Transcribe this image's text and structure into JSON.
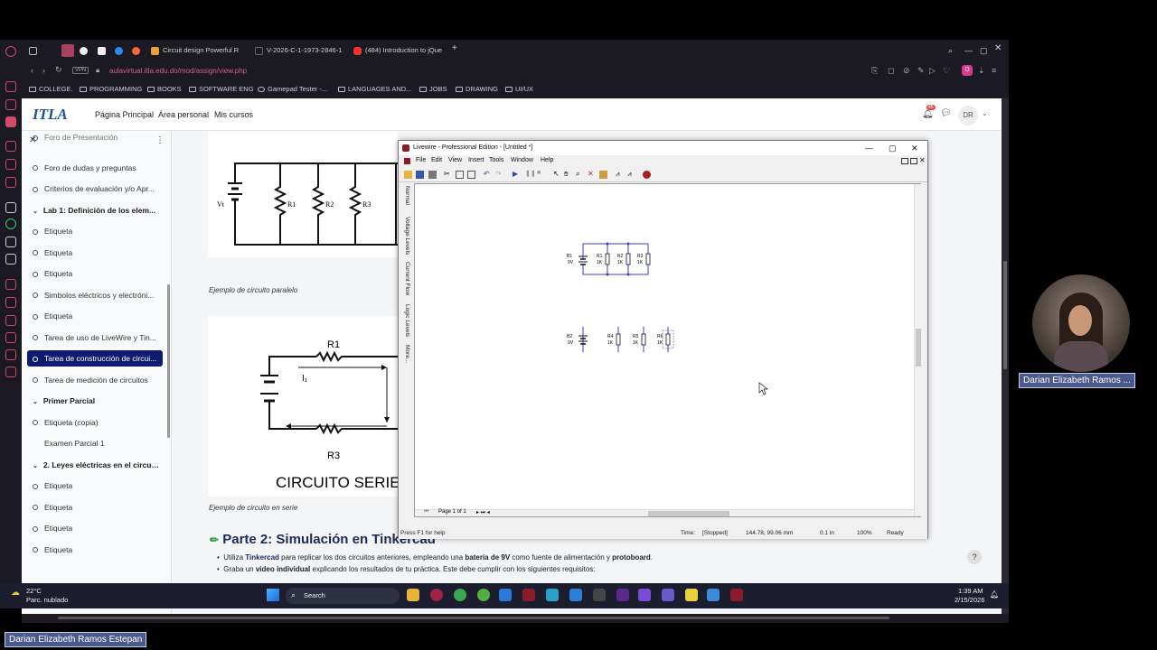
{
  "browser": {
    "tabs": [
      {
        "label": "Circuit design Powerful R"
      },
      {
        "label": "V-2026-C-1-1973-2846-1"
      },
      {
        "label": "(484) Introduction to jQue"
      }
    ],
    "url": "aulavirtual.itla.edu.do/mod/assign/view.php",
    "bookmarks": [
      "COLLEGE.",
      "PROGRAMMING",
      "BOOKS",
      "SOFTWARE ENG",
      "Gamepad Tester -...",
      "LANGUAGES AND...",
      "JOBS",
      "DRAWING",
      "UI/UX"
    ],
    "notification_count": "45"
  },
  "moodle": {
    "logo": "ITLA",
    "nav": [
      "Página Principal",
      "Área personal",
      "Mis cursos"
    ],
    "user_initials": "DR",
    "drawer_items": [
      {
        "label": "Foro de Presentación",
        "type": "item"
      },
      {
        "label": "Foro de dudas y preguntas",
        "type": "item"
      },
      {
        "label": "Criterios de evaluación y/o Apr...",
        "type": "item"
      },
      {
        "label": "Lab 1: Definición de los elem...",
        "type": "section"
      },
      {
        "label": "Etiqueta",
        "type": "item"
      },
      {
        "label": "Etiqueta",
        "type": "item"
      },
      {
        "label": "Etiqueta",
        "type": "item"
      },
      {
        "label": "Simbolos eléctricos y electróni...",
        "type": "item"
      },
      {
        "label": "Etiqueta",
        "type": "item"
      },
      {
        "label": "Tarea de uso de LiveWire y Tin...",
        "type": "item"
      },
      {
        "label": "Tarea de construcción de circui...",
        "type": "active"
      },
      {
        "label": "Tarea de medición de circuitos",
        "type": "item"
      },
      {
        "label": "Primer Parcial",
        "type": "section"
      },
      {
        "label": "Etiqueta (copia)",
        "type": "item"
      },
      {
        "label": "Examen Parcial 1",
        "type": "plain"
      },
      {
        "label": "2. Leyes eléctricas en el circui...",
        "type": "section"
      },
      {
        "label": "Etiqueta",
        "type": "item"
      },
      {
        "label": "Etiqueta",
        "type": "item"
      },
      {
        "label": "Etiqueta",
        "type": "item"
      },
      {
        "label": "Etiqueta",
        "type": "item"
      }
    ],
    "parallel_caption": "Ejemplo de circuito paralelo",
    "parallel_labels": [
      "Vt",
      "R1",
      "R2",
      "R3"
    ],
    "series_labels": [
      "R1",
      "I₁",
      "R3"
    ],
    "series_title": "CIRCUITO SERIE",
    "series_caption": "Ejemplo de circuito en serie",
    "part2_title": "Parte 2: Simulación en Tinkercad",
    "bullet1_pre": "Utiliza ",
    "bullet1_b1": "Tinkercad",
    "bullet1_mid": " para replicar los dos circuitos anteriores, empleando una ",
    "bullet1_b2": "batería de 9V",
    "bullet1_mid2": " como fuente de alimentación y ",
    "bullet1_b3": "protoboard",
    "bullet1_end": ".",
    "bullet2_pre": "Graba un ",
    "bullet2_b": "video individual",
    "bullet2_end": " explicando los resultados de tu práctica. Este debe cumplir con los siguientes requisitos:",
    "help": "?"
  },
  "livewire": {
    "title": "Livewire - Professional Edition - [Untitled *]",
    "menu": [
      "File",
      "Edit",
      "View",
      "Insert",
      "Tools",
      "Window",
      "Help"
    ],
    "vtabs": [
      "Normal",
      "Voltage Levels",
      "Current Flow",
      "Logic Levels",
      "More..."
    ],
    "parallel": {
      "battery": "B1",
      "battery_value": "9V",
      "resistors": [
        {
          "name": "R1",
          "value": "1K"
        },
        {
          "name": "R2",
          "value": "1K"
        },
        {
          "name": "R3",
          "value": "1K"
        }
      ]
    },
    "series": {
      "battery": "B2",
      "battery_value": "9V",
      "resistors": [
        {
          "name": "R4",
          "value": "1K"
        },
        {
          "name": "R5",
          "value": "1K"
        },
        {
          "name": "R6",
          "value": "1K"
        }
      ]
    },
    "page_indicator": "Page 1 of 1",
    "status": {
      "help": "Press F1 for help",
      "time": "Time:",
      "state": "[Stopped]",
      "coords": "144.78, 99.06 mm",
      "grid": "0.1 in",
      "zoom": "100%",
      "ready": "Ready"
    }
  },
  "taskbar": {
    "temp": "22°C",
    "weather": "Parc. nublado",
    "search": "Search",
    "time": "1:39 AM",
    "date": "2/15/2026"
  },
  "webcam_name": "Darian Elizabeth Ramos ...",
  "bottom_name": "Darian Elizabeth Ramos Estepan"
}
